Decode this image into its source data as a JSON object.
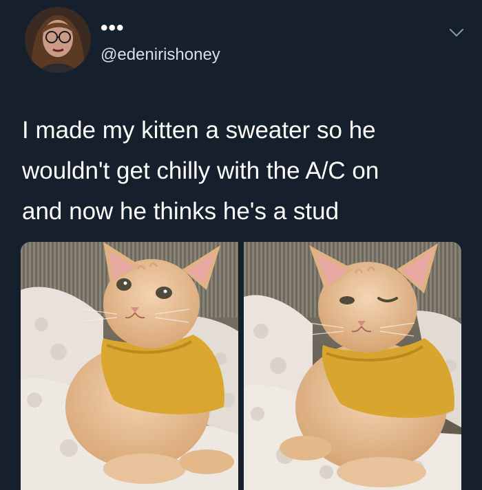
{
  "tweet": {
    "display_name": "•••",
    "handle": "@edenirishoney",
    "text_lines": [
      "I made my kitten a sweater so he",
      "wouldn't get chilly with the A/C on",
      "and now he thinks he's a stud"
    ]
  },
  "icons": {
    "menu": "chevron-down-icon"
  },
  "colors": {
    "background": "#16202c",
    "text": "#ffffff",
    "handle": "#d9dfe5",
    "sweater": "#d9a72f",
    "kitten": "#e8b98a"
  }
}
